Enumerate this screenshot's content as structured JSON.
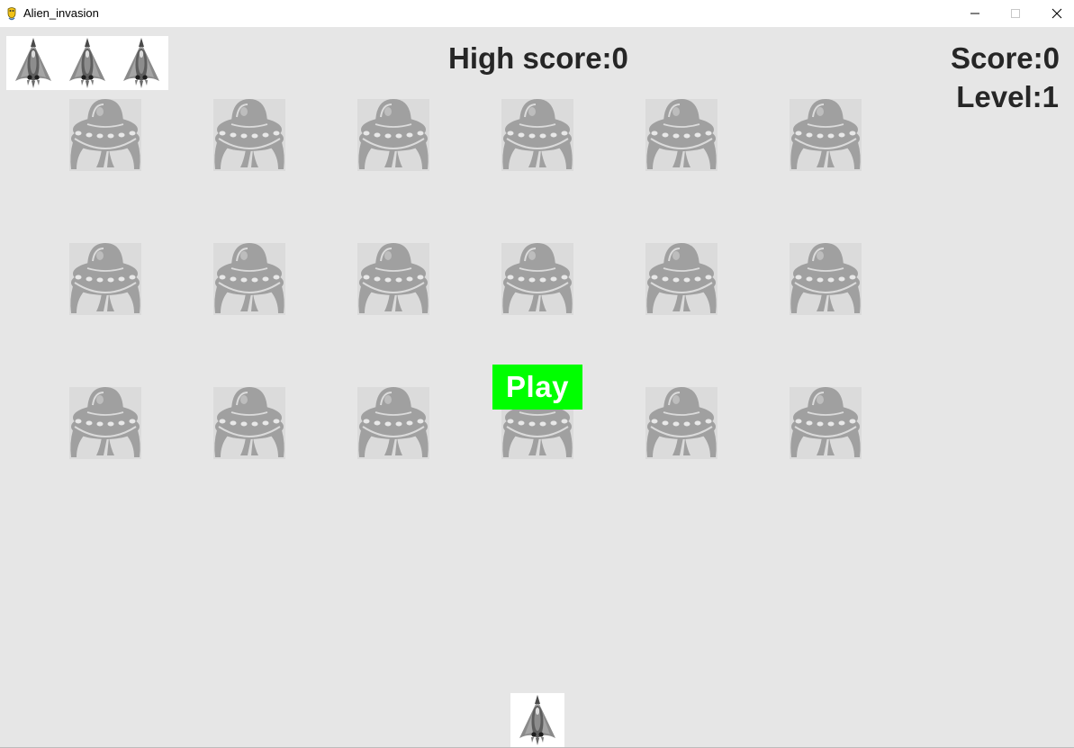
{
  "window": {
    "title": "Alien_invasion",
    "icons": {
      "app": "pygame-snake-icon",
      "minimize": "minimize-icon",
      "maximize": "maximize-icon",
      "close": "close-icon"
    }
  },
  "hud": {
    "high_score_label": "High score:0",
    "score_label": "Score:0",
    "level_label": "Level:1",
    "lives_remaining": 3
  },
  "game": {
    "play_button_label": "Play",
    "alien_rows": 3,
    "aliens_per_row": 6,
    "colors": {
      "background": "#e6e6e6",
      "play_button": "#00ff00",
      "play_text": "#ffffff",
      "hud_text": "#262626"
    }
  }
}
